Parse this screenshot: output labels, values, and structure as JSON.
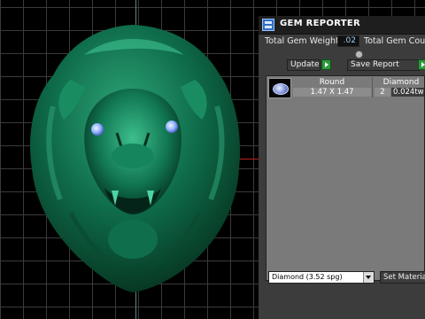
{
  "panel": {
    "title": "GEM REPORTER",
    "total_gem_weight_label": "Total Gem Weight",
    "total_gem_weight_value": ".02",
    "total_gem_count_label": "Total Gem Coun",
    "update_label": "Update",
    "save_report_label": "Save Report"
  },
  "gem_table": {
    "headers": [
      "Round",
      "Diamond"
    ],
    "rows": [
      {
        "size": "1.47 X 1.47",
        "count": "2",
        "weight": "0.024tw"
      }
    ]
  },
  "material_select": {
    "value": "Diamond    (3.52 spg)"
  },
  "set_material_label": "Set Materia",
  "colors": {
    "model": "#0e6b4a",
    "gems": "#8fb4ff",
    "grid": "#3a3a3a",
    "panel": "#3c3c3c",
    "go_button": "#2a9a3a"
  },
  "icons": [
    "gem-reporter-app-icon",
    "play-arrow-icon",
    "chevron-down-icon",
    "round-gem-icon"
  ]
}
